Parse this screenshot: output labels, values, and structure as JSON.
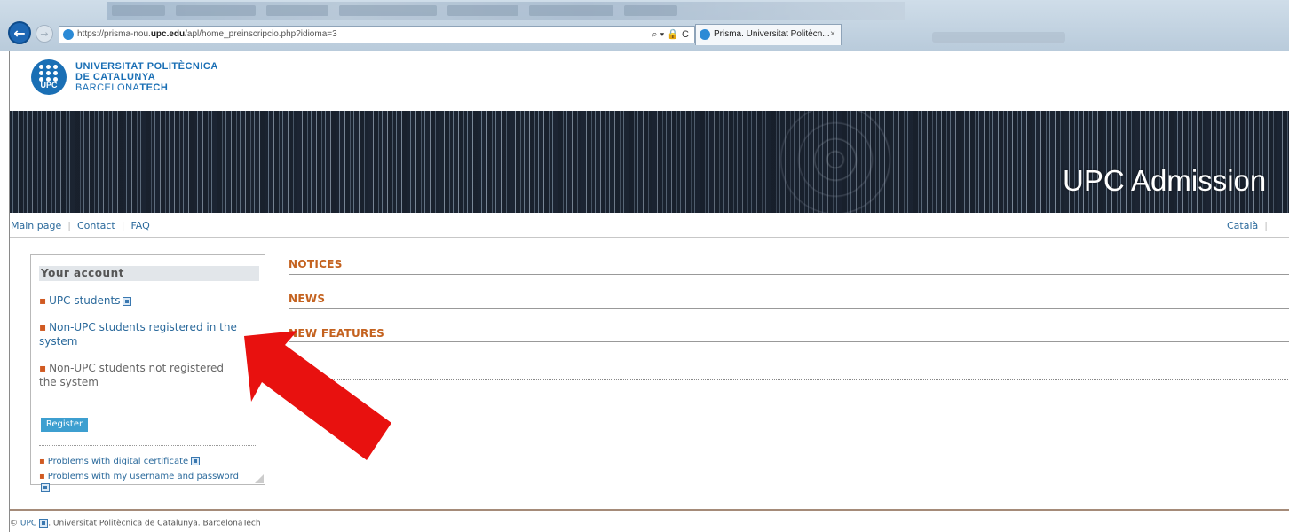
{
  "browser": {
    "url_prefix": "https://prisma-nou.",
    "url_domain": "upc.edu",
    "url_suffix": "/apl/home_preinscripcio.php?idioma=3",
    "url_tools": "⌕ ▾ 🔒 C",
    "tab_title": "Prisma. Universitat Politècn...",
    "tab_close": "×"
  },
  "logo": {
    "mark": "UPC",
    "line1": "UNIVERSITAT POLITÈCNICA",
    "line2": "DE CATALUNYA",
    "line3_light": "BARCELONA",
    "line3_bold": "TECH"
  },
  "banner": {
    "title": "UPC Admission"
  },
  "nav": {
    "items": [
      "Main page",
      "Contact",
      "FAQ"
    ],
    "language": "Català",
    "separator": "|"
  },
  "account": {
    "title": "Your account",
    "upc_students": "UPC students",
    "registered_line1": "Non-UPC students registered in the",
    "registered_line2": "system",
    "not_registered_line1": "Non-UPC students not registered",
    "not_registered_line2": "the system",
    "register_button": "Register",
    "problems_certificate": "Problems with digital certificate",
    "problems_login": "Problems with my username and password",
    "bullet": "▪"
  },
  "sections": {
    "notices": "NOTICES",
    "news": "NEWS",
    "new_features": "NEW FEATURES"
  },
  "footer": {
    "copyright": "©",
    "link": "UPC",
    "text": ". Universitat Politècnica de Catalunya. BarcelonaTech"
  },
  "colors": {
    "accent_blue": "#1a6fb5",
    "link_blue": "#2b6a9c",
    "section_orange": "#c4621f",
    "annotation_red": "#e8110f",
    "register_button": "#3d9fd0"
  }
}
